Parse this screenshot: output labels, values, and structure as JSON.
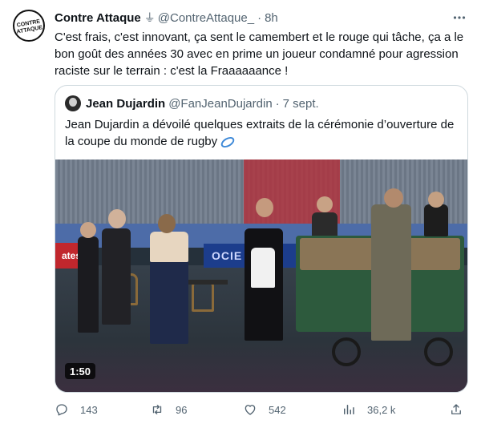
{
  "tweet": {
    "author_name": "Contre Attaque",
    "badge_icon": "⏚",
    "handle": "@ContreAttaque_",
    "separator": "·",
    "time": "8h",
    "text": "C'est frais, c'est innovant, ça sent le camembert et le rouge qui tâche, ça a le bon goût des années 30 avec en prime un joueur condamné pour agression raciste sur le terrain : c'est la Fraaaaaance !"
  },
  "quoted": {
    "author_name": "Jean Dujardin",
    "handle": "@FanJeanDujardin",
    "separator": "·",
    "time": "7 sept.",
    "text": "Jean Dujardin a dévoilé quelques extraits de la cérémonie d’ouverture de la coupe du monde de rugby"
  },
  "media": {
    "duration": "1:50",
    "banner_left": "ates",
    "banner_center": "OCIE ENER"
  },
  "actions": {
    "replies": "143",
    "retweets": "96",
    "likes": "542",
    "views": "36,2 k"
  },
  "icons": [
    "contre-attaque-logo",
    "more-icon",
    "rugby-ball-icon",
    "reply-icon",
    "retweet-icon",
    "like-icon",
    "views-icon",
    "share-icon"
  ],
  "colors": {
    "muted": "#536471",
    "text": "#0f1419",
    "border": "#cfd9de",
    "rugby": "#3f8ad8"
  }
}
